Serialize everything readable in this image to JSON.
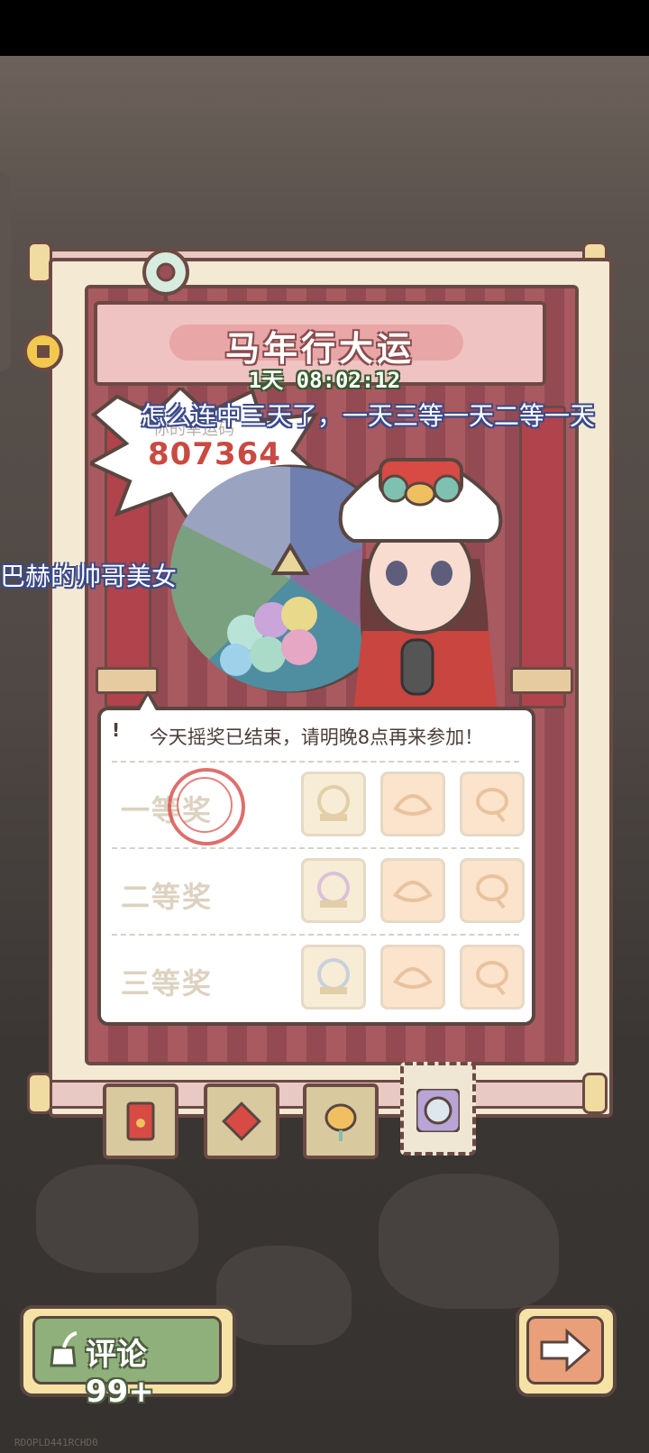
{
  "event": {
    "title": "马年行大运",
    "countdown": "1天 08:02:12",
    "lucky_code_label": "你的幸运码",
    "lucky_code": "807364"
  },
  "danmaku": [
    {
      "text": "怎么连中三天了，一天三等一天二等一天"
    },
    {
      "text": "巴赫的帅哥美女"
    }
  ],
  "prize_card": {
    "notice": "今天摇奖已结束，请明晚8点再来参加！",
    "tiers": [
      {
        "label": "一等奖",
        "stamped": true
      },
      {
        "label": "二等奖",
        "stamped": false
      },
      {
        "label": "三等奖",
        "stamped": false
      }
    ]
  },
  "tabs": [
    {
      "icon": "red-envelope-icon",
      "active": false
    },
    {
      "icon": "fu-charm-icon",
      "active": false
    },
    {
      "icon": "lantern-icon",
      "active": false
    },
    {
      "icon": "gacha-ball-icon",
      "active": true
    }
  ],
  "comment_button": {
    "label": "评论 99+"
  },
  "watermark": "RDOPLD441RCHD0",
  "colors": {
    "lucky_code": "#c94a43",
    "danmaku_outline": "#3a4a8a",
    "comment_green": "#8fb07a"
  }
}
